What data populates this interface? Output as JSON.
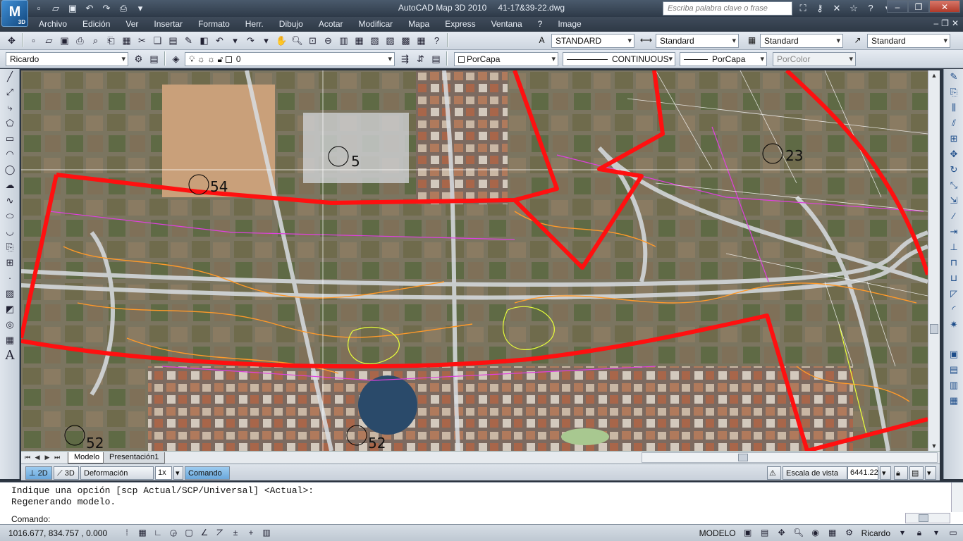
{
  "titlebar": {
    "app_badge": "3D",
    "app_name": "AutoCAD Map 3D 2010",
    "document": "41-17&39-22.dwg",
    "search_placeholder": "Escriba palabra clave o frase"
  },
  "menu": {
    "items": [
      "Archivo",
      "Edición",
      "Ver",
      "Insertar",
      "Formato",
      "Herr.",
      "Dibujo",
      "Acotar",
      "Modificar",
      "Mapa",
      "Express",
      "Ventana",
      "?",
      "Image"
    ]
  },
  "styles_toolbar": {
    "text_style": "STANDARD",
    "dim_style": "Standard",
    "table_style": "Standard",
    "mleader_style": "Standard"
  },
  "layers_toolbar": {
    "workspace": "Ricardo",
    "layer": "0",
    "color": "PorCapa",
    "linetype": "CONTINUOUS",
    "lineweight": "PorCapa",
    "plotstyle": "PorColor"
  },
  "map_labels": [
    "54",
    "5",
    "23",
    "52",
    "52"
  ],
  "tabs": {
    "model": "Modelo",
    "layout": "Presentación1"
  },
  "map_status": {
    "mode_2d": "2D",
    "mode_3d": "3D",
    "vertical_label": "Deformación vertical:",
    "vertical_value": "1x",
    "command_button": "Comando",
    "scale_label": "Escala de vista 1:",
    "scale_value": "6441.22"
  },
  "command": {
    "history": [
      "Indique una opción [scp Actual/SCP/Universal] <Actual>:",
      "Regenerando modelo."
    ],
    "prompt": "Comando:"
  },
  "statusbar": {
    "coordinates": "1016.677, 834.757 , 0.000",
    "space": "MODELO",
    "workspace": "Ricardo"
  },
  "colors": {
    "boundary": "#ff1010",
    "road_lines": "#ffffff",
    "contours": "#ff9a2a",
    "parcels": "#e040e0"
  }
}
